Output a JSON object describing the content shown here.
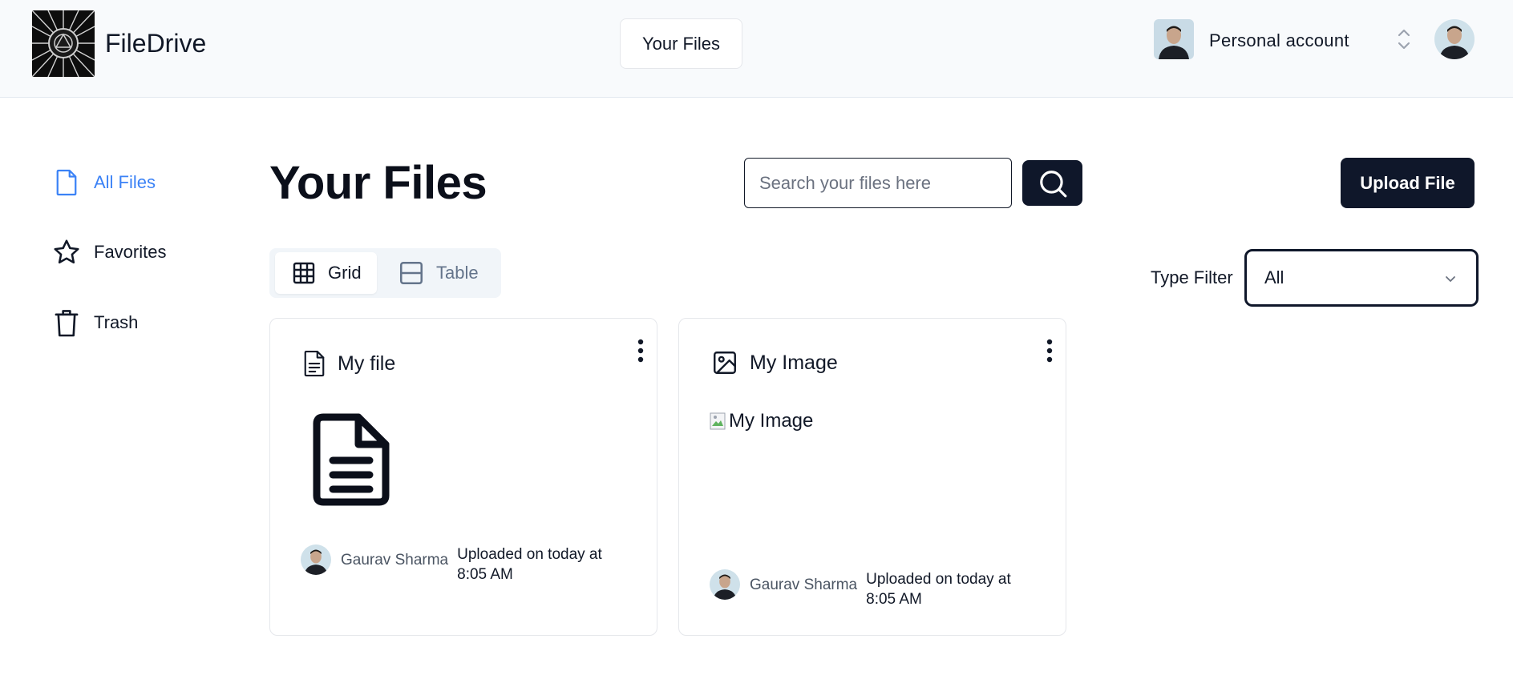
{
  "header": {
    "brand": "FileDrive",
    "nav_button": "Your Files",
    "account_label": "Personal account"
  },
  "sidebar": {
    "items": [
      {
        "label": "All Files",
        "icon": "file-icon",
        "active": true
      },
      {
        "label": "Favorites",
        "icon": "star-icon",
        "active": false
      },
      {
        "label": "Trash",
        "icon": "trash-icon",
        "active": false
      }
    ]
  },
  "main": {
    "title": "Your Files",
    "search_placeholder": "Search your files here",
    "upload_label": "Upload File",
    "tabs": [
      {
        "label": "Grid",
        "active": true
      },
      {
        "label": "Table",
        "active": false
      }
    ],
    "filter_label": "Type Filter",
    "filter_value": "All"
  },
  "files": [
    {
      "name": "My file",
      "type": "pdf",
      "uploader": "Gaurav Sharma",
      "uploaded": "Uploaded on today at 8:05 AM"
    },
    {
      "name": "My Image",
      "type": "image",
      "image_alt": "My Image",
      "uploader": "Gaurav Sharma",
      "uploaded": "Uploaded on today at 8:05 AM"
    }
  ],
  "colors": {
    "accent": "#3b82f6",
    "primary_button": "#0f172a",
    "header_bg": "#f8fafc"
  }
}
